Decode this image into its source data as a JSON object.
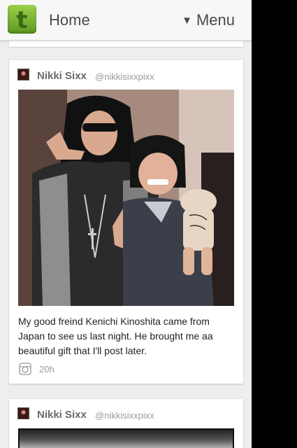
{
  "header": {
    "logo_letter": "t",
    "title": "Home",
    "menu_label": "Menu",
    "menu_icon": "triangle-down-icon",
    "accent": "#6aa82a"
  },
  "posts": [
    {
      "author": "Nikki Sixx",
      "handle": "@nikkisixxpixx",
      "caption": "My good freind Kenichi Kinoshita came from Japan to see us last night. He brought me aa beautiful gift that I'll post later.",
      "source_icon": "instagram-icon",
      "time": "20h"
    },
    {
      "author": "Nikki Sixx",
      "handle": "@nikkisixxpixx"
    }
  ]
}
